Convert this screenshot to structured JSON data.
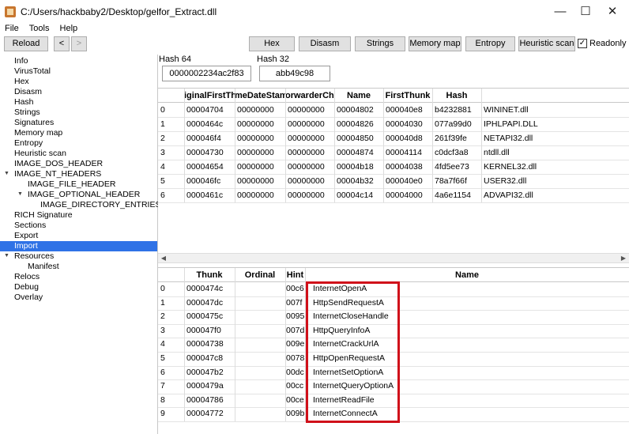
{
  "window": {
    "title": "C:/Users/hackbaby2/Desktop/gelfor_Extract.dll",
    "minimize": "—",
    "maximize": "☐",
    "close": "✕"
  },
  "menu": {
    "file": "File",
    "tools": "Tools",
    "help": "Help"
  },
  "toolbar": {
    "reload": "Reload",
    "back": "<",
    "forward": ">",
    "hex": "Hex",
    "disasm": "Disasm",
    "strings": "Strings",
    "memory_map": "Memory map",
    "entropy": "Entropy",
    "heuristic": "Heuristic scan",
    "readonly_check": "✓",
    "readonly": "Readonly"
  },
  "tree": {
    "info": "Info",
    "virustotal": "VirusTotal",
    "hex": "Hex",
    "disasm": "Disasm",
    "hash": "Hash",
    "strings": "Strings",
    "signatures": "Signatures",
    "memory_map": "Memory map",
    "entropy": "Entropy",
    "heuristic": "Heuristic scan",
    "dos_header": "IMAGE_DOS_HEADER",
    "nt_headers": "IMAGE_NT_HEADERS",
    "file_header": "IMAGE_FILE_HEADER",
    "optional_header": "IMAGE_OPTIONAL_HEADER",
    "data_dirs": "IMAGE_DIRECTORY_ENTRIES",
    "rich": "RICH Signature",
    "sections": "Sections",
    "export": "Export",
    "import": "Import",
    "resources": "Resources",
    "manifest": "Manifest",
    "relocs": "Relocs",
    "debug": "Debug",
    "overlay": "Overlay"
  },
  "hashes": {
    "hash64_label": "Hash 64",
    "hash64_value": "0000002234ac2f83",
    "hash32_label": "Hash 32",
    "hash32_value": "abb49c98"
  },
  "imports_table": {
    "headers": [
      "iginalFirstThu",
      "meDateStam",
      "orwarderChai",
      "Name",
      "FirstThunk",
      "Hash",
      ""
    ],
    "rows": [
      [
        "0",
        "00004704",
        "00000000",
        "00000000",
        "00004802",
        "000040e8",
        "b4232881",
        "WININET.dll"
      ],
      [
        "1",
        "0000464c",
        "00000000",
        "00000000",
        "00004826",
        "00004030",
        "077a99d0",
        "IPHLPAPI.DLL"
      ],
      [
        "2",
        "000046f4",
        "00000000",
        "00000000",
        "00004850",
        "000040d8",
        "261f39fe",
        "NETAPI32.dll"
      ],
      [
        "3",
        "00004730",
        "00000000",
        "00000000",
        "00004874",
        "00004114",
        "c0dcf3a8",
        "ntdll.dll"
      ],
      [
        "4",
        "00004654",
        "00000000",
        "00000000",
        "00004b18",
        "00004038",
        "4fd5ee73",
        "KERNEL32.dll"
      ],
      [
        "5",
        "000046fc",
        "00000000",
        "00000000",
        "00004b32",
        "000040e0",
        "78a7f66f",
        "USER32.dll"
      ],
      [
        "6",
        "0000461c",
        "00000000",
        "00000000",
        "00004c14",
        "00004000",
        "4a6e1154",
        "ADVAPI32.dll"
      ]
    ]
  },
  "scroll": {
    "left": "◀",
    "right": "▶"
  },
  "functions_table": {
    "headers": [
      "Thunk",
      "Ordinal",
      "Hint",
      "Name"
    ],
    "rows": [
      [
        "0",
        "0000474c",
        "",
        "00c6",
        "InternetOpenA"
      ],
      [
        "1",
        "000047dc",
        "",
        "007f",
        "HttpSendRequestA"
      ],
      [
        "2",
        "0000475c",
        "",
        "0095",
        "InternetCloseHandle"
      ],
      [
        "3",
        "000047f0",
        "",
        "007d",
        "HttpQueryInfoA"
      ],
      [
        "4",
        "00004738",
        "",
        "009e",
        "InternetCrackUrlA"
      ],
      [
        "5",
        "000047c8",
        "",
        "0078",
        "HttpOpenRequestA"
      ],
      [
        "6",
        "000047b2",
        "",
        "00dc",
        "InternetSetOptionA"
      ],
      [
        "7",
        "0000479a",
        "",
        "00cc",
        "InternetQueryOptionA"
      ],
      [
        "8",
        "00004786",
        "",
        "00ce",
        "InternetReadFile"
      ],
      [
        "9",
        "00004772",
        "",
        "009b",
        "InternetConnectA"
      ]
    ]
  },
  "colors": {
    "selection": "#2f72e6",
    "highlight_box": "#d0101a"
  }
}
